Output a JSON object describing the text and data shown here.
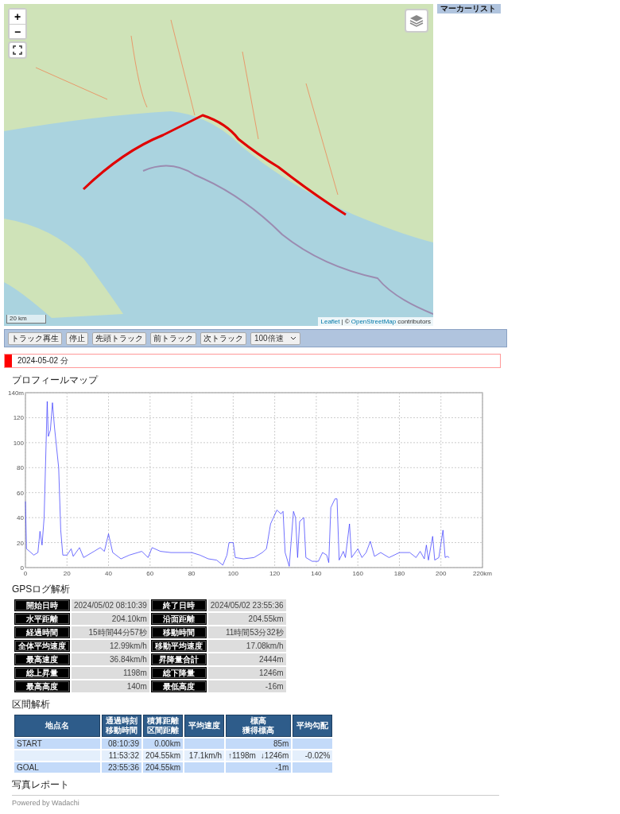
{
  "map": {
    "zoom_in": "+",
    "zoom_out": "−",
    "scale": "20 km",
    "attribution_link1": "Leaflet",
    "attribution_sep": "| ©",
    "attribution_link2": "OpenStreetMap",
    "attribution_tail": "contributors"
  },
  "marker_list": {
    "title": "マーカーリスト"
  },
  "toolbar": {
    "buttons": [
      "トラック再生",
      "停止",
      "先頭トラック",
      "前トラック",
      "次トラック"
    ],
    "speed": "100倍速"
  },
  "day_header": {
    "title": "2024-05-02 分"
  },
  "profile": {
    "title": "プロフィールマップ",
    "chart_data": {
      "type": "line",
      "grid": true,
      "xlim": [
        0,
        220
      ],
      "ylim": [
        0,
        140
      ],
      "xticks": [
        0,
        20,
        40,
        60,
        80,
        100,
        120,
        140,
        160,
        180,
        200,
        {
          "value": 220,
          "label": "220km"
        }
      ],
      "yticks": [
        0,
        20,
        40,
        60,
        80,
        100,
        120,
        {
          "value": 140,
          "label": "140m"
        }
      ],
      "series": [
        {
          "color": "#3333ff",
          "x": [
            0,
            0.5,
            2,
            4,
            6,
            7,
            8,
            9,
            10.5,
            11,
            12,
            13,
            14,
            16,
            17,
            18,
            20,
            22,
            23,
            26,
            28,
            33,
            36,
            38,
            40,
            42,
            46,
            50,
            56,
            59,
            61,
            65,
            70,
            80,
            84,
            88,
            92,
            95,
            97,
            98,
            100,
            101,
            105,
            110,
            114,
            116,
            118,
            121,
            123,
            124,
            125,
            127,
            129,
            130,
            131,
            132,
            134,
            135,
            138,
            141,
            143,
            145,
            146,
            147,
            149,
            150,
            151,
            153,
            154,
            156,
            157,
            160,
            162,
            164,
            166,
            168,
            171,
            175,
            180,
            185,
            188,
            190,
            192,
            193,
            194,
            196,
            197,
            199,
            201,
            202,
            203,
            204
          ],
          "values": [
            53,
            15,
            13,
            10,
            12,
            29,
            18,
            40,
            133,
            105,
            110,
            132,
            112,
            80,
            30,
            10,
            10,
            15,
            9,
            16,
            8,
            13,
            16,
            13,
            27,
            12,
            7,
            10,
            13,
            8,
            16,
            13,
            12,
            12,
            10,
            7,
            6,
            2,
            10,
            20,
            20,
            8,
            7,
            8,
            12,
            15,
            35,
            46,
            43,
            45,
            12,
            1,
            45,
            40,
            8,
            37,
            40,
            8,
            5,
            5,
            12,
            10,
            4,
            48,
            55,
            55,
            6,
            13,
            8,
            35,
            8,
            15,
            8,
            12,
            21,
            9,
            12,
            8,
            12,
            12,
            8,
            13,
            7,
            18,
            6,
            25,
            6,
            8,
            30,
            8,
            9,
            8
          ]
        }
      ]
    }
  },
  "gps": {
    "title": "GPSログ解析",
    "rows": [
      [
        "開始日時",
        "2024/05/02 08:10:39",
        "終了日時",
        "2024/05/02 23:55:36"
      ],
      [
        "水平距離",
        "204.10km",
        "沿面距離",
        "204.55km"
      ],
      [
        "経過時間",
        "15時間44分57秒",
        "移動時間",
        "11時間53分32秒"
      ],
      [
        "全体平均速度",
        "12.99km/h",
        "移動平均速度",
        "17.08km/h"
      ],
      [
        "最高速度",
        "36.84km/h",
        "昇降量合計",
        "2444m"
      ],
      [
        "総上昇量",
        "1198m",
        "総下降量",
        "1246m"
      ],
      [
        "最高高度",
        "140m",
        "最低高度",
        "-16m"
      ]
    ]
  },
  "sections": {
    "title": "区間解析",
    "columns": [
      {
        "lines": [
          "地点名"
        ]
      },
      {
        "lines": [
          "通過時刻",
          "移動時間"
        ]
      },
      {
        "lines": [
          "積算距離",
          "区間距離"
        ]
      },
      {
        "lines": [
          "平均速度"
        ]
      },
      {
        "lines": [
          "標高",
          "獲得標高"
        ]
      },
      {
        "lines": [
          "平均勾配"
        ]
      }
    ],
    "rows": [
      {
        "kind": "point",
        "cells": [
          [
            "START"
          ],
          [
            "08:10:39"
          ],
          [
            "0.00km"
          ],
          [],
          [
            "85m"
          ],
          []
        ]
      },
      {
        "kind": "segment",
        "cells": [
          [],
          [
            "11:53:32"
          ],
          [
            "204.55km"
          ],
          [
            "17.1km/h"
          ],
          [
            "↑1198m",
            "↓1246m"
          ],
          [
            "-0.02%"
          ]
        ]
      },
      {
        "kind": "point",
        "cells": [
          [
            "GOAL"
          ],
          [
            "23:55:36"
          ],
          [
            "204.55km"
          ],
          [],
          [
            "-1m"
          ],
          []
        ]
      }
    ]
  },
  "photo_report": {
    "title": "写真レポート"
  },
  "footer": {
    "text": "Powered by Wadachi"
  }
}
